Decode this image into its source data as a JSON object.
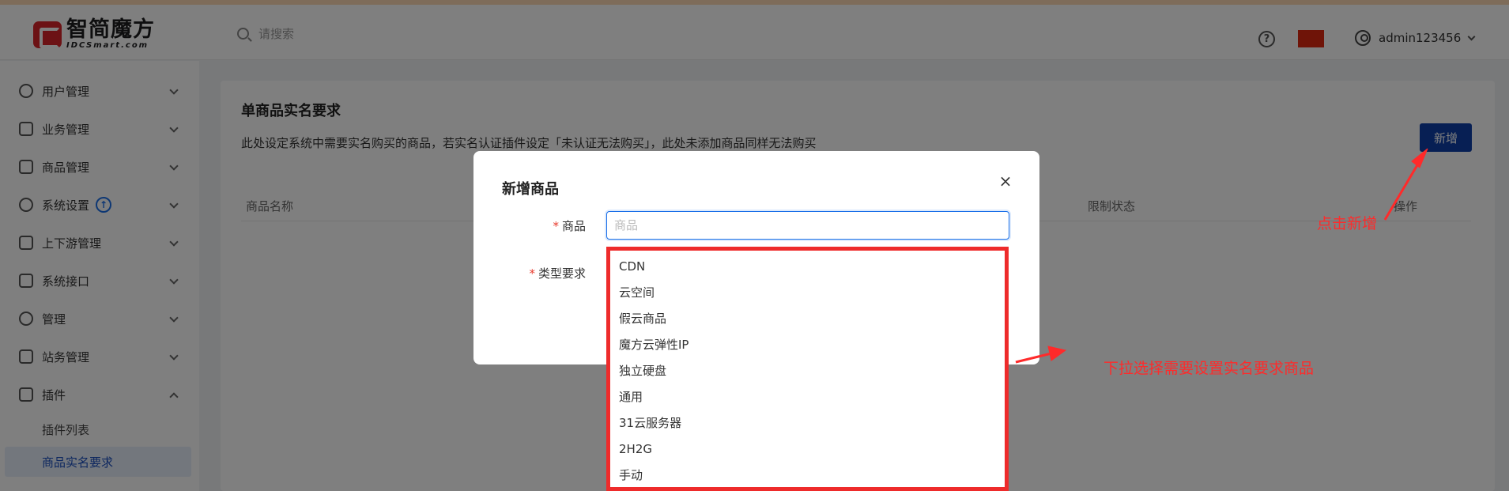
{
  "header": {
    "logo_cn": "智简魔方",
    "logo_en": "IDCSmart.com",
    "search_placeholder": "请搜索",
    "help_symbol": "?",
    "username": "admin123456"
  },
  "sidebar": {
    "items": [
      {
        "label": "用户管理",
        "icon": "user-icon"
      },
      {
        "label": "业务管理",
        "icon": "list-icon"
      },
      {
        "label": "商品管理",
        "icon": "cart-icon"
      },
      {
        "label": "系统设置",
        "icon": "gear-icon",
        "badge": "↑"
      },
      {
        "label": "上下游管理",
        "icon": "filter-icon"
      },
      {
        "label": "系统接口",
        "icon": "folder-icon"
      },
      {
        "label": "管理",
        "icon": "sparkle-icon"
      },
      {
        "label": "站务管理",
        "icon": "window-icon"
      },
      {
        "label": "插件",
        "icon": "cube-icon",
        "expanded": true
      }
    ],
    "sub_items": [
      {
        "label": "插件列表",
        "active": false
      },
      {
        "label": "商品实名要求",
        "active": true
      }
    ]
  },
  "page": {
    "title": "单商品实名要求",
    "description": "此处设定系统中需要实名购买的商品，若实名认证插件设定「未认证无法购买」，此处未添加商品同样无法购买",
    "add_button": "新增",
    "table_headers": [
      "商品名称",
      "限制状态",
      "操作"
    ]
  },
  "modal": {
    "title": "新增商品",
    "close_symbol": "×",
    "goods_label": "商品",
    "goods_placeholder": "商品",
    "type_label": "类型要求",
    "required_mark": "*"
  },
  "dropdown": {
    "options": [
      "CDN",
      "云空间",
      "假云商品",
      "魔方云弹性IP",
      "独立硬盘",
      "通用",
      "31云服务器",
      "2H2G",
      "手动"
    ]
  },
  "annotations": {
    "click_add": "点击新增",
    "select_hint": "下拉选择需要设置实名要求商品",
    "color": "#ff2a2a"
  }
}
